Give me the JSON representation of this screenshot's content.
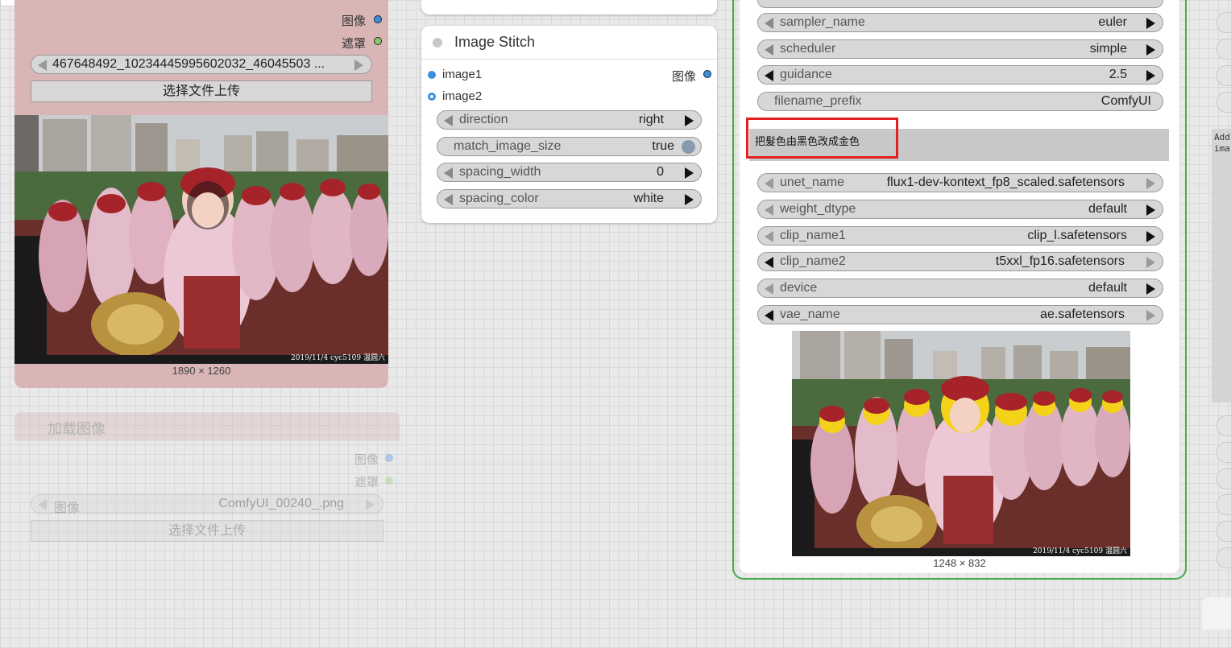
{
  "canvas": {
    "background": "#e9e9e9"
  },
  "load_image_node": {
    "output_image_label": "图像",
    "output_mask_label": "遮罩",
    "image_widget_value": "467648492_10234445995602032_46045503 ...",
    "upload_button_label": "选择文件上传",
    "image_size": "1890 × 1260",
    "watermark": "2019/11/4 cyc5109 温圆六"
  },
  "load_image_node_2": {
    "title": "加载图像",
    "output_image_label": "图像",
    "output_mask_label": "遮罩",
    "image_widget_label": "图像",
    "image_widget_value": "ComfyUI_00240_.png",
    "upload_button_label": "选择文件上传"
  },
  "image_stitch_node": {
    "title": "Image Stitch",
    "input1": "image1",
    "input2": "image2",
    "output_label": "图像",
    "widgets": [
      {
        "name": "direction",
        "value": "right"
      },
      {
        "name": "match_image_size",
        "value": "true"
      },
      {
        "name": "spacing_width",
        "value": "0"
      },
      {
        "name": "spacing_color",
        "value": "white"
      }
    ]
  },
  "flux_node": {
    "top_widgets": [
      {
        "name": "sampler_name",
        "value": "euler"
      },
      {
        "name": "scheduler",
        "value": "simple"
      },
      {
        "name": "guidance",
        "value": "2.5"
      },
      {
        "name": "filename_prefix",
        "value": "ComfyUI"
      }
    ],
    "prompt_text": "把髮色由黑色改成金色",
    "model_widgets": [
      {
        "name": "unet_name",
        "value": "flux1-dev-kontext_fp8_scaled.safetensors"
      },
      {
        "name": "weight_dtype",
        "value": "default"
      },
      {
        "name": "clip_name1",
        "value": "clip_l.safetensors"
      },
      {
        "name": "clip_name2",
        "value": "t5xxl_fp16.safetensors"
      },
      {
        "name": "device",
        "value": "default"
      },
      {
        "name": "vae_name",
        "value": "ae.safetensors"
      }
    ],
    "output_size": "1248 × 832",
    "watermark": "2019/11/4 cyc5109 温圆六"
  },
  "right_panel": {
    "text": "Add ima"
  },
  "colors": {
    "node_pink": "#d9b5b5",
    "selected_outline": "#3fae3f",
    "highlight_box": "#e02020",
    "image_dot": "#3b8fe0",
    "mask_dot": "#8cc86a"
  }
}
